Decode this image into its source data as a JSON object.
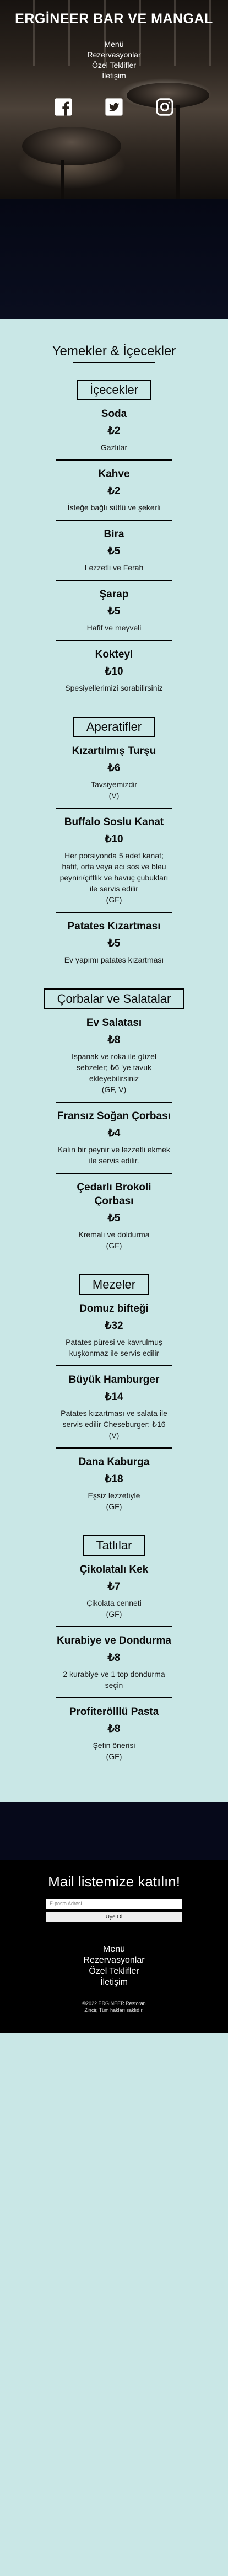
{
  "header": {
    "logo": "ERGİNEER BAR VE MANGAL",
    "nav": [
      "Menü",
      "Rezervasyonlar",
      "Özel Teklifler",
      "İletişim"
    ],
    "socials": [
      "facebook-icon",
      "twitter-icon",
      "instagram-icon"
    ]
  },
  "menu": {
    "title": "Yemekler & İçecekler",
    "categories": [
      {
        "name": "İçecekler",
        "items": [
          {
            "name": "Soda",
            "price": "₺2",
            "desc": "Gazlılar",
            "tag": ""
          },
          {
            "name": "Kahve",
            "price": "₺2",
            "desc": "İsteğe bağlı sütlü ve şekerli",
            "tag": ""
          },
          {
            "name": "Bira",
            "price": "₺5",
            "desc": "Lezzetli ve Ferah",
            "tag": ""
          },
          {
            "name": "Şarap",
            "price": "₺5",
            "desc": "Hafif ve meyveli",
            "tag": ""
          },
          {
            "name": "Kokteyl",
            "price": "₺10",
            "desc": "Spesiyellerimizi sorabilirsiniz",
            "tag": ""
          }
        ]
      },
      {
        "name": "Aperatifler",
        "items": [
          {
            "name": "Kızartılmış Turşu",
            "price": "₺6",
            "desc": "Tavsiyemizdir",
            "tag": "(V)"
          },
          {
            "name": "Buffalo Soslu Kanat",
            "price": "₺10",
            "desc": "Her porsiyonda 5 adet kanat; hafif, orta veya acı sos ve bleu peyniri/çiftlik ve havuç çubukları ile servis edilir",
            "tag": "(GF)"
          },
          {
            "name": "Patates Kızartması",
            "price": "₺5",
            "desc": "Ev yapımı patates kızartması",
            "tag": ""
          }
        ]
      },
      {
        "name": "Çorbalar ve Salatalar",
        "items": [
          {
            "name": "Ev Salatası",
            "price": "₺8",
            "desc": "Ispanak ve roka ile güzel sebzeler; ₺6 'ye tavuk ekleyebilirsiniz",
            "tag": "(GF, V)"
          },
          {
            "name": "Fransız Soğan Çorbası",
            "price": "₺4",
            "desc": "Kalın bir peynir ve lezzetli ekmek ile servis edilir.",
            "tag": ""
          },
          {
            "name": "Çedarlı Brokoli Çorbası",
            "price": "₺5",
            "desc": "Kremalı ve doldurma",
            "tag": "(GF)"
          }
        ]
      },
      {
        "name": "Mezeler",
        "items": [
          {
            "name": "Domuz bifteği",
            "price": "₺32",
            "desc": "Patates püresi ve kavrulmuş kuşkonmaz ile servis edilir",
            "tag": ""
          },
          {
            "name": "Büyük Hamburger",
            "price": "₺14",
            "desc": "Patates kızartması ve salata ile servis edilir Cheseburger: ₺16",
            "tag": "(V)"
          },
          {
            "name": "Dana Kaburga",
            "price": "₺18",
            "desc": "Eşsiz lezzetiyle",
            "tag": "(GF)"
          }
        ]
      },
      {
        "name": "Tatlılar",
        "items": [
          {
            "name": "Çikolatalı Kek",
            "price": "₺7",
            "desc": "Çikolata cenneti",
            "tag": "(GF)"
          },
          {
            "name": "Kurabiye ve Dondurma",
            "price": "₺8",
            "desc": "2 kurabiye ve 1 top dondurma seçin",
            "tag": ""
          },
          {
            "name": "Profiterölllü Pasta",
            "price": "₺8",
            "desc": "Şefin önerisi",
            "tag": "(GF)"
          }
        ]
      }
    ]
  },
  "footer": {
    "heading": "Mail listemize katılın!",
    "email_placeholder": "E-posta Adresi",
    "subscribe_label": "Üye Ol",
    "nav": [
      "Menü",
      "Rezervasyonlar",
      "Özel Teklifler",
      "İletişim"
    ],
    "copyright_1": "©2022 ERGİNEER Restoran",
    "copyright_2": "Zincir, Tüm hakları saklıdır."
  },
  "colors": {
    "accent": "#c9e7e6",
    "dark": "#000000",
    "band": "#050814"
  }
}
